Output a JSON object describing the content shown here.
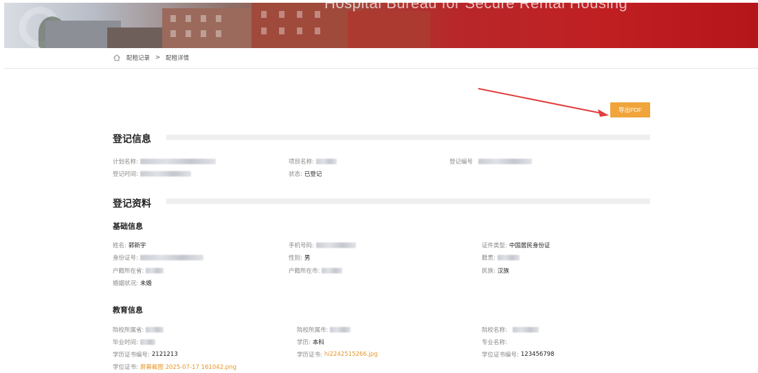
{
  "banner": {
    "title": "Hospital Bureau for Secure Rental Housing"
  },
  "breadcrumb": {
    "items": [
      "配租记录",
      ">",
      "配租详情"
    ]
  },
  "toolbar": {
    "export_label": "导出PDF"
  },
  "registration_info": {
    "title": "登记信息",
    "fields": [
      {
        "label": "计划名称:",
        "value": ""
      },
      {
        "label": "项目名称:",
        "value": ""
      },
      {
        "label": "登记编号",
        "value": ""
      },
      {
        "label": "登记时间:",
        "value": ""
      },
      {
        "label": "状态:",
        "value": "已登记"
      }
    ]
  },
  "registration_data": {
    "title": "登记资料",
    "basic": {
      "title": "基础信息",
      "fields": [
        {
          "label": "姓名:",
          "value": "郭新宇"
        },
        {
          "label": "手机号码:",
          "value": ""
        },
        {
          "label": "证件类型:",
          "value": "中国居民身份证"
        },
        {
          "label": "身份证号:",
          "value": ""
        },
        {
          "label": "性别:",
          "value": "男"
        },
        {
          "label": "籍贯:",
          "value": ""
        },
        {
          "label": "户籍所在省:",
          "value": ""
        },
        {
          "label": "户籍所在市:",
          "value": ""
        },
        {
          "label": "民族:",
          "value": "汉族"
        },
        {
          "label": "婚姻状况:",
          "value": "未婚"
        }
      ]
    },
    "education": {
      "title": "教育信息",
      "fields": [
        {
          "label": "院校所属省:",
          "value": ""
        },
        {
          "label": "院校所属市:",
          "value": ""
        },
        {
          "label": "院校名称:",
          "value": ""
        },
        {
          "label": "毕业时间:",
          "value": ""
        },
        {
          "label": "学历:",
          "value": "本科"
        },
        {
          "label": "专业名称:",
          "value": ""
        },
        {
          "label": "学历证书编号:",
          "value": "2121213"
        },
        {
          "label": "学历证书:",
          "value": "hi2242515266.jpg"
        },
        {
          "label": "学位证书编号:",
          "value": "123456798"
        },
        {
          "label": "学位证书:",
          "value": "屏幕截图 2025-07-17 161042.png"
        }
      ]
    }
  }
}
